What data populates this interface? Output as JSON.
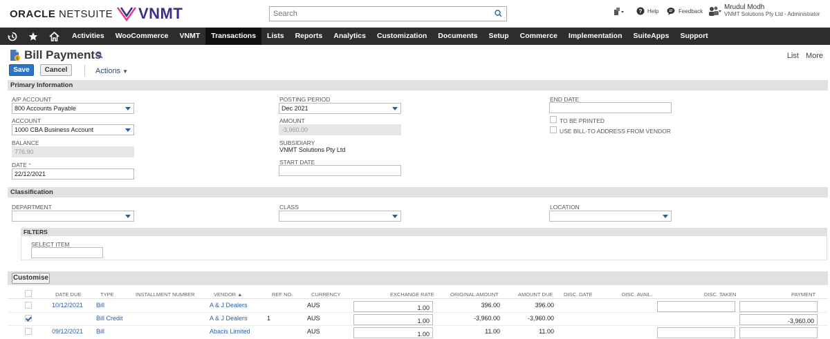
{
  "header": {
    "brand_oracle": "ORACLE",
    "brand_netsuite": " NETSUITE",
    "brand_vnmt": "VNMT",
    "search_placeholder": "Search",
    "help": "Help",
    "feedback": "Feedback",
    "user_name": "Mrudul Modh",
    "user_role": "VNMT Solutions Pty Ltd - Administrator"
  },
  "nav": {
    "items": [
      "Activities",
      "WooCommerce",
      "VNMT",
      "Transactions",
      "Lists",
      "Reports",
      "Analytics",
      "Customization",
      "Documents",
      "Setup",
      "Commerce",
      "Implementation",
      "SuiteApps",
      "Support"
    ],
    "active": "Transactions"
  },
  "page": {
    "title": "Bill Payments",
    "list_link": "List",
    "more_link": "More",
    "save_label": "Save",
    "cancel_label": "Cancel",
    "actions_label": "Actions"
  },
  "primary": {
    "section_title": "Primary Information",
    "ap_account_label": "A/P ACCOUNT",
    "ap_account_value": "800 Accounts Payable",
    "account_label": "ACCOUNT",
    "account_value": "1000 CBA Business Account",
    "balance_label": "BALANCE",
    "balance_value": "776.90",
    "date_label": "DATE",
    "date_value": "22/12/2021",
    "posting_period_label": "POSTING PERIOD",
    "posting_period_value": "Dec 2021",
    "amount_label": "AMOUNT",
    "amount_value": "-3,960.00",
    "subsidiary_label": "SUBSIDIARY",
    "subsidiary_value": "VNMT Solutions Pty Ltd",
    "start_date_label": "START DATE",
    "start_date_value": "",
    "end_date_label": "END DATE",
    "end_date_value": "",
    "to_be_printed_label": "TO BE PRINTED",
    "use_bill_to_label": "USE BILL-TO ADDRESS FROM VENDOR"
  },
  "classification": {
    "section_title": "Classification",
    "department_label": "DEPARTMENT",
    "class_label": "CLASS",
    "location_label": "LOCATION"
  },
  "filters": {
    "title": "FILTERS",
    "select_item_label": "SELECT ITEM"
  },
  "sublist": {
    "customise_label": "Customise",
    "columns": {
      "date_due": "DATE DUE",
      "type": "TYPE",
      "installment": "INSTALLMENT NUMBER",
      "vendor": "VENDOR ▲",
      "ref_no": "REF NO.",
      "currency": "CURRENCY",
      "exchange_rate": "EXCHANGE RATE",
      "original_amount": "ORIGINAL AMOUNT",
      "amount_due": "AMOUNT DUE",
      "disc_date": "DISC. DATE",
      "disc_avail": "DISC. AVAIL.",
      "disc_taken": "DISC. TAKEN",
      "payment": "PAYMENT"
    },
    "rows": [
      {
        "date_due": "10/12/2021",
        "type": "Bill",
        "vendor": "A & J Dealers",
        "ref_no": "",
        "currency": "AUS",
        "exchange_rate": "1.00",
        "original_amount": "396.00",
        "amount_due": "396.00",
        "payment": "",
        "checked": false
      },
      {
        "date_due": "",
        "type": "Bill Credit",
        "vendor": "A & J Dealers",
        "ref_no": "1",
        "currency": "AUS",
        "exchange_rate": "1.00",
        "original_amount": "-3,960.00",
        "amount_due": "-3,960.00",
        "payment": "-3,960.00",
        "checked": true
      },
      {
        "date_due": "09/12/2021",
        "type": "Bill",
        "vendor": "Abacis Limited",
        "ref_no": "",
        "currency": "AUS",
        "exchange_rate": "1.00",
        "original_amount": "11.00",
        "amount_due": "11.00",
        "payment": "",
        "checked": false
      }
    ]
  },
  "colors": {
    "nav_bg": "#2d2d2d",
    "save_blue": "#2b74c7",
    "link_blue": "#2a5ea8",
    "section_grey": "#e1e1e1"
  }
}
